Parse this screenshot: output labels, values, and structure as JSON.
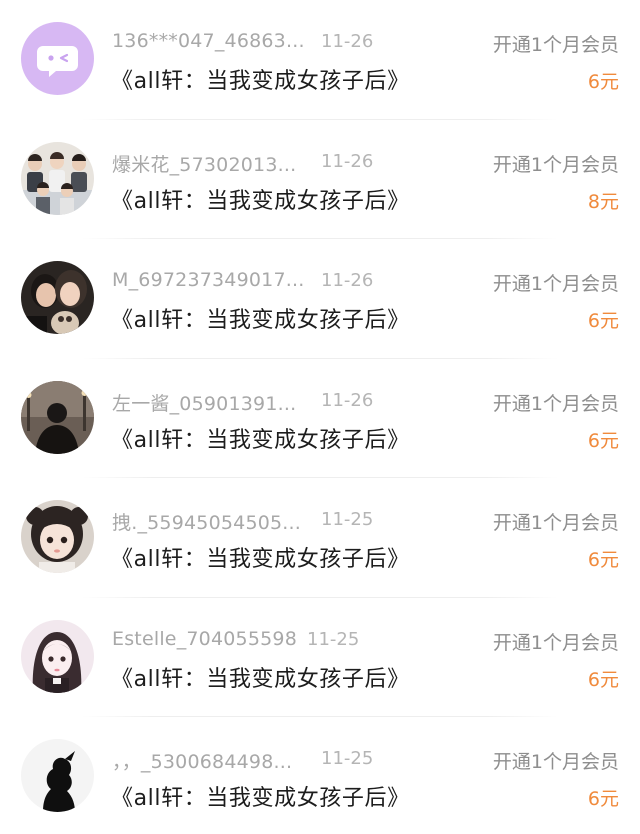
{
  "purchases": [
    {
      "username": "136***047_46863...",
      "date": "11-26",
      "action": "开通1个月会员",
      "title": "《all轩：当我变成女孩子后》",
      "price": "6元",
      "avatar": "default-chat-avatar"
    },
    {
      "username": "爆米花_57302013...",
      "date": "11-26",
      "action": "开通1个月会员",
      "title": "《all轩：当我变成女孩子后》",
      "price": "8元",
      "avatar": "group-photo-avatar"
    },
    {
      "username": "M_697237349017...",
      "date": "11-26",
      "action": "开通1个月会员",
      "title": "《all轩：当我变成女孩子后》",
      "price": "6元",
      "avatar": "couple-photo-avatar"
    },
    {
      "username": "左一酱_05901391...",
      "date": "11-26",
      "action": "开通1个月会员",
      "title": "《all轩：当我变成女孩子后》",
      "price": "6元",
      "avatar": "dark-silhouette-avatar"
    },
    {
      "username": "拽._55945054505...",
      "date": "11-25",
      "action": "开通1个月会员",
      "title": "《all轩：当我变成女孩子后》",
      "price": "6元",
      "avatar": "child-photo-avatar"
    },
    {
      "username": "Estelle_704055598",
      "date": "11-25",
      "action": "开通1个月会员",
      "title": "《all轩：当我变成女孩子后》",
      "price": "6元",
      "avatar": "girl-photo-avatar"
    },
    {
      "username": "，，_5300684498...",
      "date": "11-25",
      "action": "开通1个月会员",
      "title": "《all轩：当我变成女孩子后》",
      "price": "6元",
      "avatar": "black-silhouette-avatar"
    }
  ],
  "colors": {
    "price": "#f08a3c",
    "username": "#a8a8a8",
    "title": "#1d1d1d",
    "default_avatar_bg": "#d7b8f3"
  }
}
